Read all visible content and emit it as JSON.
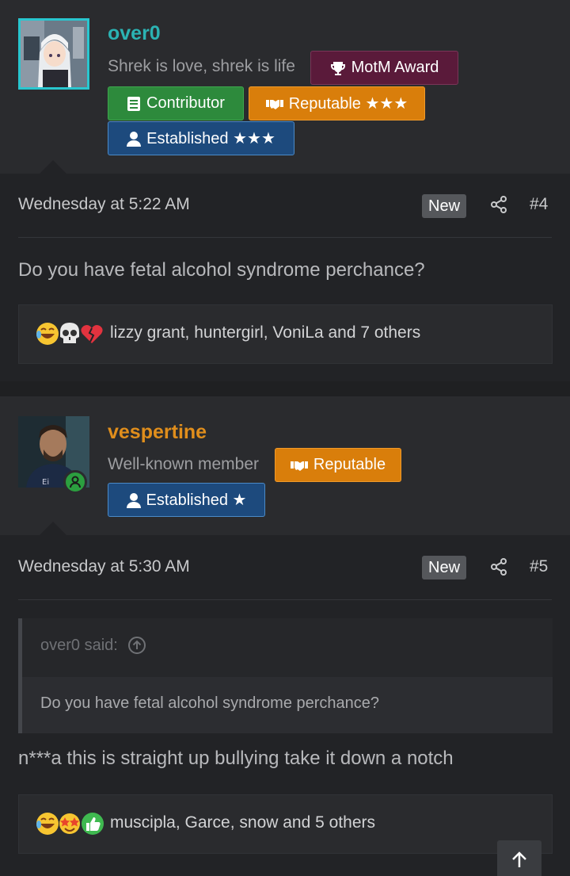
{
  "posts": [
    {
      "author": {
        "username": "over0",
        "username_color": "#2bb3b3",
        "title": "Shrek is love, shrek is life",
        "badges": {
          "motm": "MotM Award",
          "contributor": "Contributor",
          "reputable": "Reputable ★★★",
          "established": "Established ★★★"
        }
      },
      "date": "Wednesday at 5:22 AM",
      "new_label": "New",
      "number": "#4",
      "message": "Do you have fetal alcohol syndrome perchance?",
      "reactions": {
        "icons": [
          "laughing-emoji",
          "skull-emoji",
          "broken-heart-emoji"
        ],
        "text": "lizzy grant, huntergirl, VoniLa and 7 others"
      }
    },
    {
      "author": {
        "username": "vespertine",
        "username_color": "#e08e1c",
        "title": "Well-known member",
        "online": true,
        "badges": {
          "reputable": "Reputable",
          "established": "Established ★"
        }
      },
      "date": "Wednesday at 5:30 AM",
      "new_label": "New",
      "number": "#5",
      "quote": {
        "author_line": "over0 said:",
        "text": "Do you have fetal alcohol syndrome perchance?"
      },
      "message": "n***a this is straight up bullying take it down a notch",
      "reactions": {
        "icons": [
          "laughing-emoji",
          "star-struck-emoji",
          "thumbs-up-emoji"
        ],
        "text": "muscipla, Garce, snow and 5 others"
      }
    }
  ],
  "colors": {
    "motm_bg": "#5a1a3a",
    "contributor_bg": "#2d8a3c",
    "reputable_bg": "#d97e0b",
    "established_bg": "#1d4a7d"
  }
}
